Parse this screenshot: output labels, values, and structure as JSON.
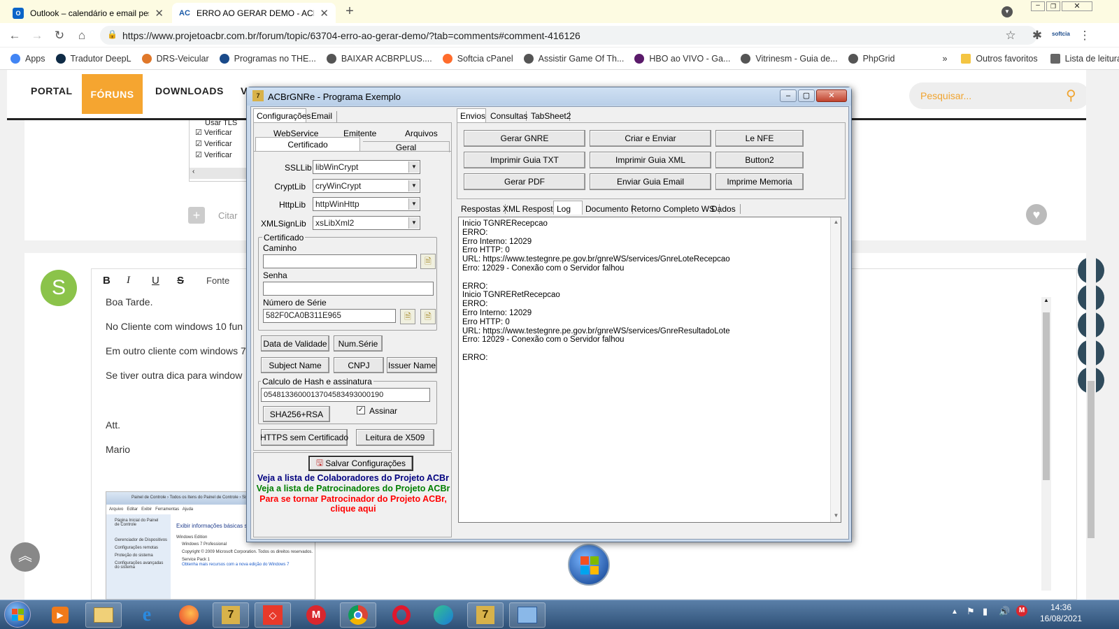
{
  "browser": {
    "tabs": [
      {
        "label": "Outlook – calendário e email pes",
        "icon": "outlook-icon",
        "active": false
      },
      {
        "label": "ERRO AO GERAR DEMO - ACBrG",
        "icon": "acbr-icon",
        "active": true
      }
    ],
    "url": "https://www.projetoacbr.com.br/forum/topic/63704-erro-ao-gerar-demo/?tab=comments#comment-416126",
    "bookmarks": [
      {
        "label": "Apps",
        "color": "#4285f4"
      },
      {
        "label": "Tradutor DeepL",
        "color": "#0f2b46"
      },
      {
        "label": "DRS-Veicular",
        "color": "#e0782a"
      },
      {
        "label": "Programas no THE...",
        "color": "#1a4a8a"
      },
      {
        "label": "BAIXAR ACBRPLUS....",
        "color": "#555555"
      },
      {
        "label": "Softcia cPanel",
        "color": "#ff6c2c"
      },
      {
        "label": "Assistir Game Of Th...",
        "color": "#555555"
      },
      {
        "label": "HBO ao VIVO - Ga...",
        "color": "#5a1a6a"
      },
      {
        "label": "Vitrinesm - Guia de...",
        "color": "#555555"
      },
      {
        "label": "PhpGrid",
        "color": "#555555"
      }
    ],
    "more": "»",
    "other_favorites": "Outros favoritos",
    "reading_list": "Lista de leitura"
  },
  "site": {
    "nav": [
      "PORTAL",
      "FÓRUNS",
      "DOWNLOADS",
      "V"
    ],
    "search_placeholder": "Pesquisar...",
    "checkbox_labels": [
      "Usar TLS",
      "Verificar",
      "Verificar",
      "Verificar"
    ],
    "quote_label": "Citar",
    "avatar_letter": "S",
    "editor_toolbar": {
      "bold": "B",
      "italic": "I",
      "underline": "U",
      "strike": "S",
      "font": "Fonte"
    },
    "post_lines": [
      "Boa Tarde.",
      "No Cliente com windows 10 fun",
      "Em outro cliente com windows 7",
      "Se tiver outra dica para window",
      "Att.",
      "Mario"
    ],
    "embedded_screenshot": {
      "breadcrumb": "Painel de Controle › Todos os Itens do Painel de Controle › Sistema",
      "menu": [
        "Arquivo",
        "Editar",
        "Exibir",
        "Ferramentas",
        "Ajuda"
      ],
      "sidebar": [
        "Página Inicial do Painel de Controle",
        "Gerenciador de Dispositivos",
        "Configurações remotas",
        "Proteção do sistema",
        "Configurações avançadas do sistema"
      ],
      "heading": "Exibir informações básicas sobre",
      "edition_label": "Windows Edition",
      "edition": "Windows 7 Professional",
      "copyright": "Copyright © 2009 Microsoft Corporation. Todos os direitos reservados.",
      "service_pack": "Service Pack 1",
      "link": "Obtenha mais recursos com a nova edição do Windows 7"
    }
  },
  "app": {
    "title": "ACBrGNRe - Programa Exemplo",
    "left_tabs": [
      "Configurações",
      "Email"
    ],
    "sub_tabs_row1": [
      "WebService",
      "Emitente",
      "Arquivos"
    ],
    "sub_tabs_row2": [
      "Certificado",
      "Geral"
    ],
    "fields": [
      {
        "label": "SSLLib",
        "value": "libWinCrypt"
      },
      {
        "label": "CryptLib",
        "value": "cryWinCrypt"
      },
      {
        "label": "HttpLib",
        "value": "httpWinHttp"
      },
      {
        "label": "XMLSignLib",
        "value": "xsLibXml2"
      }
    ],
    "cert_group": "Certificado",
    "caminho_label": "Caminho",
    "caminho_value": "",
    "senha_label": "Senha",
    "senha_value": "",
    "serie_label": "Número de Série",
    "serie_value": "582F0CA0B311E965",
    "buttons_row1": [
      "Data de Validade",
      "Num.Série"
    ],
    "buttons_row2": [
      "Subject Name",
      "CNPJ",
      "Issuer Name"
    ],
    "hash_group": "Calculo de Hash e assinatura",
    "hash_value": "05481336000137045834930001​90",
    "hash_button": "SHA256+RSA",
    "assinar_label": "Assinar",
    "assinar_checked": true,
    "https_button": "HTTPS sem Certificado",
    "x509_button": "Leitura de X509",
    "save_button": "Salvar Configurações",
    "links": [
      {
        "text": "Veja a lista de Colaboradores do Projeto ACBr",
        "color": "#00007f"
      },
      {
        "text": "Veja a lista de Patrocinadores do Projeto ACBr",
        "color": "#007f00"
      },
      {
        "text": "Para se tornar Patrocinador do Projeto ACBr,",
        "color": "#ff0000"
      },
      {
        "text": "clique aqui",
        "color": "#ff0000"
      }
    ],
    "right_tabs": [
      "Envios",
      "Consultas",
      "TabSheet2"
    ],
    "action_buttons": [
      "Gerar GNRE",
      "Criar e Enviar",
      "Le NFE",
      "Imprimir Guia TXT",
      "Imprimir Guia XML",
      "Button2",
      "Gerar PDF",
      "Enviar Guia Email",
      "Imprime Memoria"
    ],
    "result_tabs": [
      "Respostas",
      "XML Resposta",
      "Log",
      "Documento",
      "Retorno Completo WS",
      "Dados"
    ],
    "log": "Inicio TGNRERecepcao\nERRO:\nErro Interno: 12029\nErro HTTP: 0\nURL: https://www.testegnre.pe.gov.br/gnreWS/services/GnreLoteRecepcao\nErro: 12029 - Conexão com o Servidor falhou\n\nERRO:\nInicio TGNRERetRecepcao\nERRO:\nErro Interno: 12029\nErro HTTP: 0\nURL: https://www.testegnre.pe.gov.br/gnreWS/services/GnreResultadoLote\nErro: 12029 - Conexão com o Servidor falhou\n\nERRO:"
  },
  "taskbar": {
    "time": "14:36",
    "date": "16/08/2021"
  }
}
